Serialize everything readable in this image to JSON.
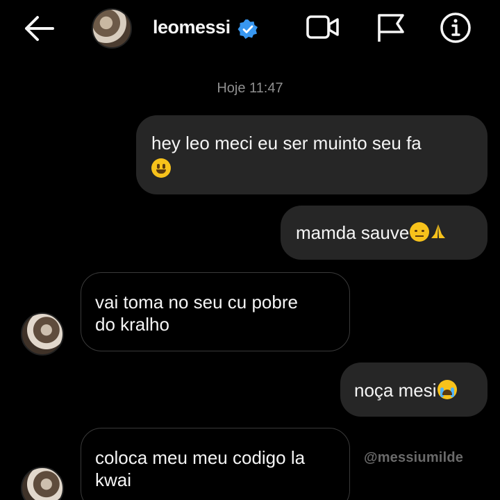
{
  "header": {
    "back_icon": "arrow-left-icon",
    "username": "leomessi",
    "verified_icon": "verified-badge-icon",
    "video_icon": "video-call-icon",
    "flag_icon": "flag-icon",
    "info_icon": "info-icon",
    "accent_color": "#3897f0"
  },
  "thread": {
    "timestamp": "Hoje 11:47",
    "messages": [
      {
        "direction": "sent",
        "text": "hey leo meci eu ser muinto seu fa",
        "emoji": "grinning-face"
      },
      {
        "direction": "sent",
        "text": "mamda sauve",
        "emoji": "pensive-face, folded-hands"
      },
      {
        "direction": "received",
        "line1": "vai toma no seu cu pobre",
        "line2": "do kralho"
      },
      {
        "direction": "sent",
        "text": "noça mesi",
        "emoji": "loudly-crying-face"
      },
      {
        "direction": "received",
        "line1": "coloca meu meu codigo la",
        "line2": "kwai"
      }
    ]
  },
  "watermark": "@messiumilde",
  "colors": {
    "background": "#000000",
    "sent_bubble": "#262626",
    "received_border": "#3a3a3a",
    "timestamp": "#8f8f8f"
  }
}
